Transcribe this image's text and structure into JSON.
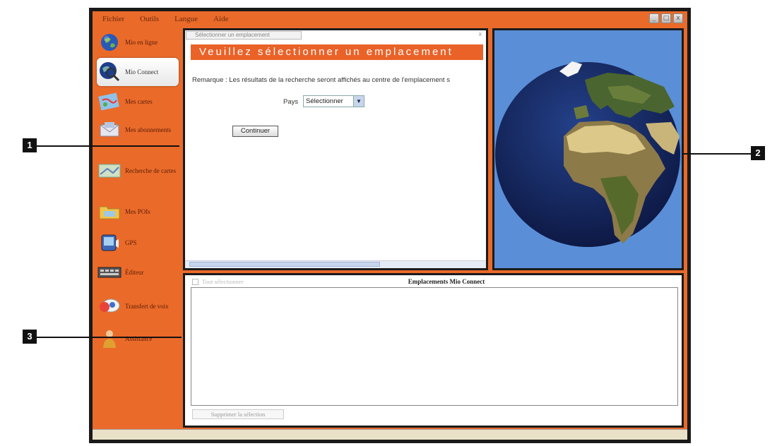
{
  "menu": [
    "Fichier",
    "Outils",
    "Langue",
    "Aide"
  ],
  "window_controls": {
    "minimize": "_",
    "maximize": "□",
    "close": "x"
  },
  "sidebar": {
    "items": [
      {
        "label": "Mio en ligne",
        "icon": "globe-icon"
      },
      {
        "label": "Mio Connect",
        "icon": "globe-search-icon",
        "active": true
      },
      {
        "label": "Mes cartes",
        "icon": "map-icon"
      },
      {
        "label": "Mes abonnements",
        "icon": "envelope-icon"
      },
      {
        "label": "Recherche de cartes",
        "icon": "map-search-icon"
      },
      {
        "label": "Mes POIs",
        "icon": "folder-icon"
      },
      {
        "label": "GPS",
        "icon": "device-icon"
      },
      {
        "label": "Éditeur",
        "icon": "keyboard-icon"
      },
      {
        "label": "Transfert de voix",
        "icon": "speech-icon"
      },
      {
        "label": "Assistance",
        "icon": "person-icon"
      }
    ]
  },
  "panel1": {
    "tab": "Sélectionner un emplacement",
    "close": "x",
    "banner": "Veuillez sélectionner un emplacement",
    "remark": "Remarque : Les résultats de la recherche seront affichés au centre de l'emplacement s",
    "pays_label": "Pays",
    "select_value": "Sélectionner",
    "continue_label": "Continuer"
  },
  "panel3": {
    "checkbox_label": "Tout sélectionner",
    "title": "Emplacements Mio Connect",
    "delete_label": "Supprimer la sélection"
  },
  "callouts": [
    "1",
    "2",
    "3"
  ],
  "colors": {
    "accent": "#ea6a2a",
    "ocean": "#1a2d6e",
    "sky": "#5a8fd8"
  }
}
